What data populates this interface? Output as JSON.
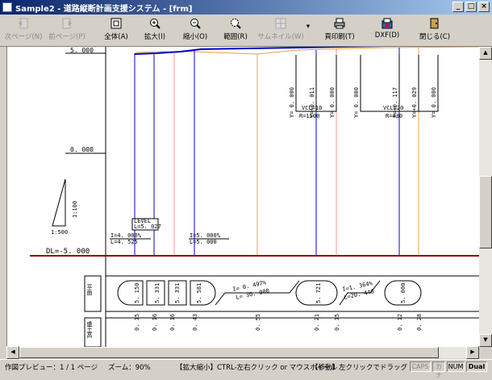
{
  "window": {
    "title": "Sample2 - 道路縦断計画支援システム - [frm]",
    "buttons": [
      "_",
      "□",
      "×"
    ]
  },
  "toolbar": {
    "prev_page": "次ページ(N)",
    "next_page": "前ページ(P)",
    "fit_all": "全体(A)",
    "zoom_in": "拡大(I)",
    "zoom_out": "縮小(O)",
    "range": "範囲(R)",
    "thumbnail": "サムネイル(W)",
    "print_page": "頁印刷(T)",
    "dxf": "DXF(D)",
    "close": "閉じる(C)"
  },
  "drawing": {
    "level_labels": [
      "5. 000",
      "0. 000"
    ],
    "dl_label": "DL=-5. 000",
    "scale_vertical": "1:100",
    "scale_horizontal": "1:500",
    "level_box": [
      "LEVEL",
      "L=5. 027"
    ],
    "grade_left": [
      "I=4. 000%",
      "L=4. 525"
    ],
    "grade_right": [
      "I=5. 000%",
      "L=5. 000"
    ],
    "y_values": [
      "Y= 0. 000",
      "Y=+0. 011",
      "Y= 0. 000",
      "Y= 0. 000",
      "Y=+0. 117",
      "Y=+0. 029",
      "Y= 0. 000"
    ],
    "vcl_left": [
      "VCL=10",
      "R=1100"
    ],
    "vcl_right": [
      "VCL=20",
      "R=430"
    ],
    "row_labels": [
      "平面",
      "盛土高"
    ],
    "radius_values": [
      "5. 150",
      "5. 331",
      "5. 331",
      "5. 581",
      "5. 721",
      "5. 000"
    ],
    "straight_left": [
      "I= 0. 497%",
      "L= 30. 000"
    ],
    "straight_right": [
      "I=1. 364%",
      "L=20. 448"
    ],
    "fill_values": [
      "0. 15",
      "0. 16",
      "0. 16",
      "0. 43",
      "0. 55",
      "0. 21",
      "0. 15",
      "0. 12",
      "0. 28"
    ]
  },
  "status": {
    "mode": "作図プレビュー：1 / 1 ページ",
    "zoom": "ズーム：90%",
    "hint1": "【拡大縮小】CTRL-左右クリック or マウスホイール",
    "hint2": "【移動】左クリックでドラッグ",
    "indicators": [
      "CAPS",
      "カナ",
      "NUM",
      "Dual"
    ]
  }
}
